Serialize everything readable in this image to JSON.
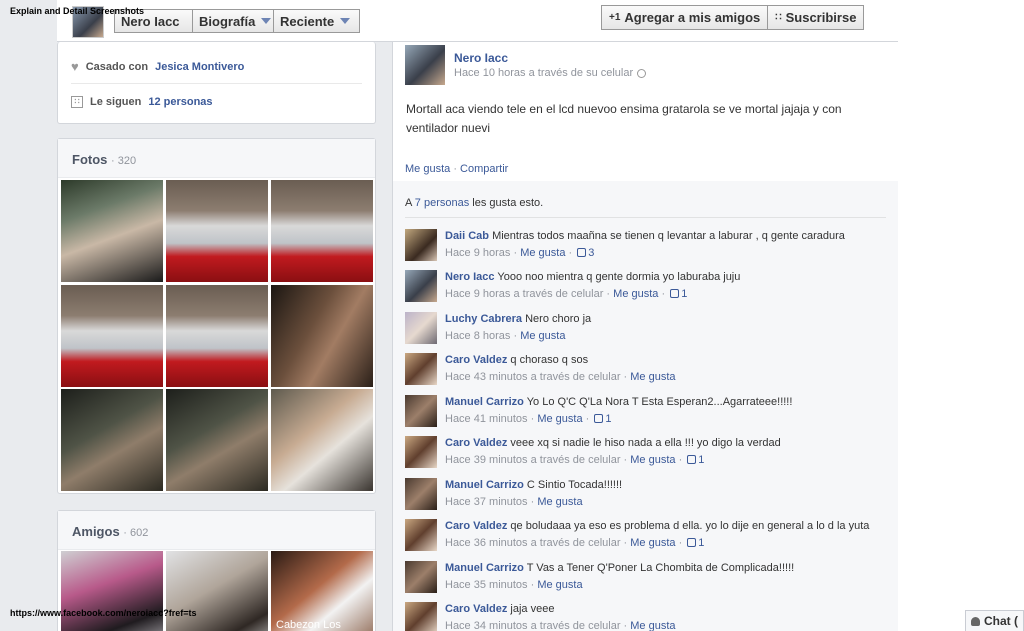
{
  "overlay": {
    "caption_top": "Explain and Detail Screenshots",
    "caption_bottom": "https://www.facebook.com/neroiacc?fref=ts"
  },
  "header": {
    "name": "Nero Iacc",
    "biografia_label": "Biografía",
    "reciente_label": "Reciente",
    "add_friend_label": "Agregar a mis amigos",
    "subscribe_label": "Suscribirse"
  },
  "about": {
    "married_prefix": "Casado con",
    "married_name": "Jesica Montivero",
    "followers_prefix": "Le siguen",
    "followers_count": "12 personas"
  },
  "photos": {
    "title": "Fotos",
    "count": "· 320"
  },
  "friends": {
    "title": "Amigos",
    "count": "· 602",
    "thumb3_label": "Cabezon Los"
  },
  "post": {
    "author": "Nero Iacc",
    "meta": "Hace 10 horas a través de su celular",
    "text": "Mortall aca viendo tele en el lcd nuevoo ensima gratarola se ve mortal jajaja y con ventilador nuevi",
    "like_label": "Me gusta",
    "share_label": "Compartir",
    "likes_prefix": "A",
    "likes_count": "7 personas",
    "likes_suffix": "les gusta esto."
  },
  "comments": [
    {
      "name": "Daii Cab",
      "text": "Mientras todos maañna se tienen q levantar a laburar , q gente caradura",
      "time": "Hace 9 horas",
      "like": "Me gusta",
      "likes": "3"
    },
    {
      "name": "Nero Iacc",
      "text": "Yooo noo mientra q gente dormia yo laburaba juju",
      "time": "Hace 9 horas a través de celular",
      "like": "Me gusta",
      "likes": "1"
    },
    {
      "name": "Luchy Cabrera",
      "text": "Nero choro ja",
      "time": "Hace 8 horas",
      "like": "Me gusta",
      "likes": ""
    },
    {
      "name": "Caro Valdez",
      "text": "q choraso q sos",
      "time": "Hace 43 minutos a través de celular",
      "like": "Me gusta",
      "likes": ""
    },
    {
      "name": "Manuel Carrizo",
      "text": "Yo Lo Q'C Q'La Nora T Esta Esperan2...Agarrateee!!!!!",
      "time": "Hace 41 minutos",
      "like": "Me gusta",
      "likes": "1"
    },
    {
      "name": "Caro Valdez",
      "text": "veee xq si nadie le hiso nada a ella !!! yo digo la verdad",
      "time": "Hace 39 minutos a través de celular",
      "like": "Me gusta",
      "likes": "1"
    },
    {
      "name": "Manuel Carrizo",
      "text": "C Sintio Tocada!!!!!!",
      "time": "Hace 37 minutos",
      "like": "Me gusta",
      "likes": ""
    },
    {
      "name": "Caro Valdez",
      "text": "qe boludaaa ya eso es problema d ella. yo lo dije en general a lo d la yuta",
      "time": "Hace 36 minutos a través de celular",
      "like": "Me gusta",
      "likes": "1"
    },
    {
      "name": "Manuel Carrizo",
      "text": "T Vas a Tener Q'Poner La Chombita de Complicada!!!!!",
      "time": "Hace 35 minutos",
      "like": "Me gusta",
      "likes": ""
    },
    {
      "name": "Caro Valdez",
      "text": "jaja veee",
      "time": "Hace 34 minutos a través de celular",
      "like": "Me gusta",
      "likes": ""
    }
  ],
  "chat": {
    "label": "Chat ("
  }
}
